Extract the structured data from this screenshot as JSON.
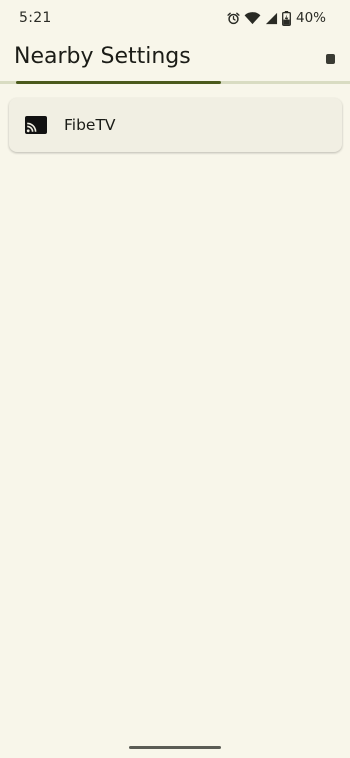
{
  "status_bar": {
    "time": "5:21",
    "battery_percent": "40%",
    "icons": [
      "alarm-icon",
      "wifi-icon",
      "cell-signal-icon",
      "battery-charging-icon"
    ]
  },
  "app_bar": {
    "title": "Nearby Settings",
    "action_icon": "stop-icon"
  },
  "scan_progress": {
    "fraction": 0.6
  },
  "devices": [
    {
      "name": "FibeTV",
      "icon": "cast-icon"
    }
  ],
  "colors": {
    "background": "#f8f6ea",
    "card": "#f1efe3",
    "progress_fill": "#4b5a1c",
    "progress_track": "#d9dcc2"
  }
}
